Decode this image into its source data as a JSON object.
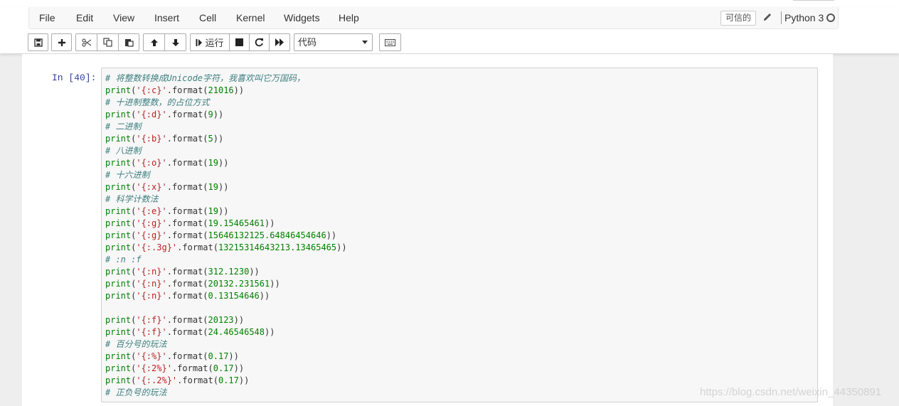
{
  "menubar": {
    "items": [
      "File",
      "Edit",
      "View",
      "Insert",
      "Cell",
      "Kernel",
      "Widgets",
      "Help"
    ],
    "trusted_label": "可信的",
    "kernel_name": "Python 3"
  },
  "toolbar": {
    "run_label": "运行",
    "cell_type": "代码"
  },
  "cell": {
    "prompt": "In [40]:",
    "lines": [
      [
        {
          "t": "cm",
          "v": "# 将整数转换成Unicode字符，我喜欢叫它万国码，"
        }
      ],
      [
        {
          "t": "kw",
          "v": "print"
        },
        {
          "t": "op",
          "v": "("
        },
        {
          "t": "str",
          "v": "'{:c}'"
        },
        {
          "t": "op",
          "v": ".format("
        },
        {
          "t": "num",
          "v": "21016"
        },
        {
          "t": "op",
          "v": "))"
        }
      ],
      [
        {
          "t": "cm",
          "v": "# 十进制整数，的占位方式"
        }
      ],
      [
        {
          "t": "kw",
          "v": "print"
        },
        {
          "t": "op",
          "v": "("
        },
        {
          "t": "str",
          "v": "'{:d}'"
        },
        {
          "t": "op",
          "v": ".format("
        },
        {
          "t": "num",
          "v": "9"
        },
        {
          "t": "op",
          "v": "))"
        }
      ],
      [
        {
          "t": "cm",
          "v": "# 二进制"
        }
      ],
      [
        {
          "t": "kw",
          "v": "print"
        },
        {
          "t": "op",
          "v": "("
        },
        {
          "t": "str",
          "v": "'{:b}'"
        },
        {
          "t": "op",
          "v": ".format("
        },
        {
          "t": "num",
          "v": "5"
        },
        {
          "t": "op",
          "v": "))"
        }
      ],
      [
        {
          "t": "cm",
          "v": "# 八进制"
        }
      ],
      [
        {
          "t": "kw",
          "v": "print"
        },
        {
          "t": "op",
          "v": "("
        },
        {
          "t": "str",
          "v": "'{:o}'"
        },
        {
          "t": "op",
          "v": ".format("
        },
        {
          "t": "num",
          "v": "19"
        },
        {
          "t": "op",
          "v": "))"
        }
      ],
      [
        {
          "t": "cm",
          "v": "# 十六进制"
        }
      ],
      [
        {
          "t": "kw",
          "v": "print"
        },
        {
          "t": "op",
          "v": "("
        },
        {
          "t": "str",
          "v": "'{:x}'"
        },
        {
          "t": "op",
          "v": ".format("
        },
        {
          "t": "num",
          "v": "19"
        },
        {
          "t": "op",
          "v": "))"
        }
      ],
      [
        {
          "t": "cm",
          "v": "# 科学计数法"
        }
      ],
      [
        {
          "t": "kw",
          "v": "print"
        },
        {
          "t": "op",
          "v": "("
        },
        {
          "t": "str",
          "v": "'{:e}'"
        },
        {
          "t": "op",
          "v": ".format("
        },
        {
          "t": "num",
          "v": "19"
        },
        {
          "t": "op",
          "v": "))"
        }
      ],
      [
        {
          "t": "kw",
          "v": "print"
        },
        {
          "t": "op",
          "v": "("
        },
        {
          "t": "str",
          "v": "'{:g}'"
        },
        {
          "t": "op",
          "v": ".format("
        },
        {
          "t": "num",
          "v": "19.15465461"
        },
        {
          "t": "op",
          "v": "))"
        }
      ],
      [
        {
          "t": "kw",
          "v": "print"
        },
        {
          "t": "op",
          "v": "("
        },
        {
          "t": "str",
          "v": "'{:g}'"
        },
        {
          "t": "op",
          "v": ".format("
        },
        {
          "t": "num",
          "v": "15646132125.64846454646"
        },
        {
          "t": "op",
          "v": "))"
        }
      ],
      [
        {
          "t": "kw",
          "v": "print"
        },
        {
          "t": "op",
          "v": "("
        },
        {
          "t": "str",
          "v": "'{:.3g}'"
        },
        {
          "t": "op",
          "v": ".format("
        },
        {
          "t": "num",
          "v": "13215314643213.13465465"
        },
        {
          "t": "op",
          "v": "))"
        }
      ],
      [
        {
          "t": "cm",
          "v": "# :n :f"
        }
      ],
      [
        {
          "t": "kw",
          "v": "print"
        },
        {
          "t": "op",
          "v": "("
        },
        {
          "t": "str",
          "v": "'{:n}'"
        },
        {
          "t": "op",
          "v": ".format("
        },
        {
          "t": "num",
          "v": "312.1230"
        },
        {
          "t": "op",
          "v": "))"
        }
      ],
      [
        {
          "t": "kw",
          "v": "print"
        },
        {
          "t": "op",
          "v": "("
        },
        {
          "t": "str",
          "v": "'{:n}'"
        },
        {
          "t": "op",
          "v": ".format("
        },
        {
          "t": "num",
          "v": "20132.231561"
        },
        {
          "t": "op",
          "v": "))"
        }
      ],
      [
        {
          "t": "kw",
          "v": "print"
        },
        {
          "t": "op",
          "v": "("
        },
        {
          "t": "str",
          "v": "'{:n}'"
        },
        {
          "t": "op",
          "v": ".format("
        },
        {
          "t": "num",
          "v": "0.13154646"
        },
        {
          "t": "op",
          "v": "))"
        }
      ],
      [],
      [
        {
          "t": "kw",
          "v": "print"
        },
        {
          "t": "op",
          "v": "("
        },
        {
          "t": "str",
          "v": "'{:f}'"
        },
        {
          "t": "op",
          "v": ".format("
        },
        {
          "t": "num",
          "v": "20123"
        },
        {
          "t": "op",
          "v": "))"
        }
      ],
      [
        {
          "t": "kw",
          "v": "print"
        },
        {
          "t": "op",
          "v": "("
        },
        {
          "t": "str",
          "v": "'{:f}'"
        },
        {
          "t": "op",
          "v": ".format("
        },
        {
          "t": "num",
          "v": "24.46546548"
        },
        {
          "t": "op",
          "v": "))"
        }
      ],
      [
        {
          "t": "cm",
          "v": "# 百分号的玩法"
        }
      ],
      [
        {
          "t": "kw",
          "v": "print"
        },
        {
          "t": "op",
          "v": "("
        },
        {
          "t": "str",
          "v": "'{:%}'"
        },
        {
          "t": "op",
          "v": ".format("
        },
        {
          "t": "num",
          "v": "0.17"
        },
        {
          "t": "op",
          "v": "))"
        }
      ],
      [
        {
          "t": "kw",
          "v": "print"
        },
        {
          "t": "op",
          "v": "("
        },
        {
          "t": "str",
          "v": "'{:2%}'"
        },
        {
          "t": "op",
          "v": ".format("
        },
        {
          "t": "num",
          "v": "0.17"
        },
        {
          "t": "op",
          "v": "))"
        }
      ],
      [
        {
          "t": "kw",
          "v": "print"
        },
        {
          "t": "op",
          "v": "("
        },
        {
          "t": "str",
          "v": "'{:.2%}'"
        },
        {
          "t": "op",
          "v": ".format("
        },
        {
          "t": "num",
          "v": "0.17"
        },
        {
          "t": "op",
          "v": "))"
        }
      ],
      [
        {
          "t": "cm",
          "v": "# 正负号的玩法"
        }
      ]
    ]
  },
  "watermark": "https://blog.csdn.net/weixin_44350891",
  "colors": {
    "comment": "#408080",
    "keyword": "#008000",
    "string": "#ba2121",
    "number": "#008000",
    "prompt": "#303f9f"
  }
}
